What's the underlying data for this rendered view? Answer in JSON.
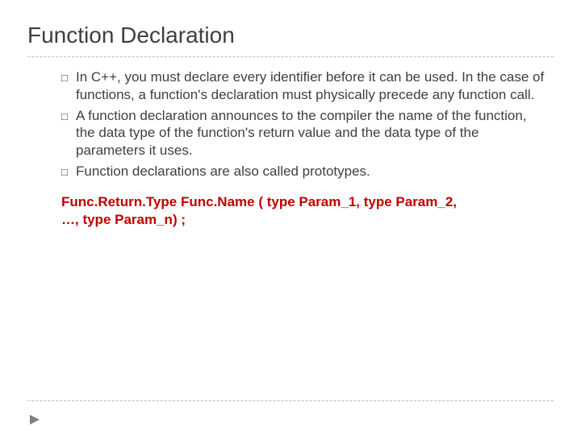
{
  "title": "Function Declaration",
  "bullets": [
    "In C++, you must declare every identifier before it can be used. In the case of functions, a function's declaration must physically precede any function call.",
    "A function declaration announces to the compiler the name of the function, the data type of the function's return value and the data type of the parameters it uses.",
    "Function declarations are also called prototypes."
  ],
  "syntax": {
    "line1": "Func.Return.Type    Func.Name ( type Param_1, type Param_2,",
    "line2": "…, type Param_n) ;"
  }
}
